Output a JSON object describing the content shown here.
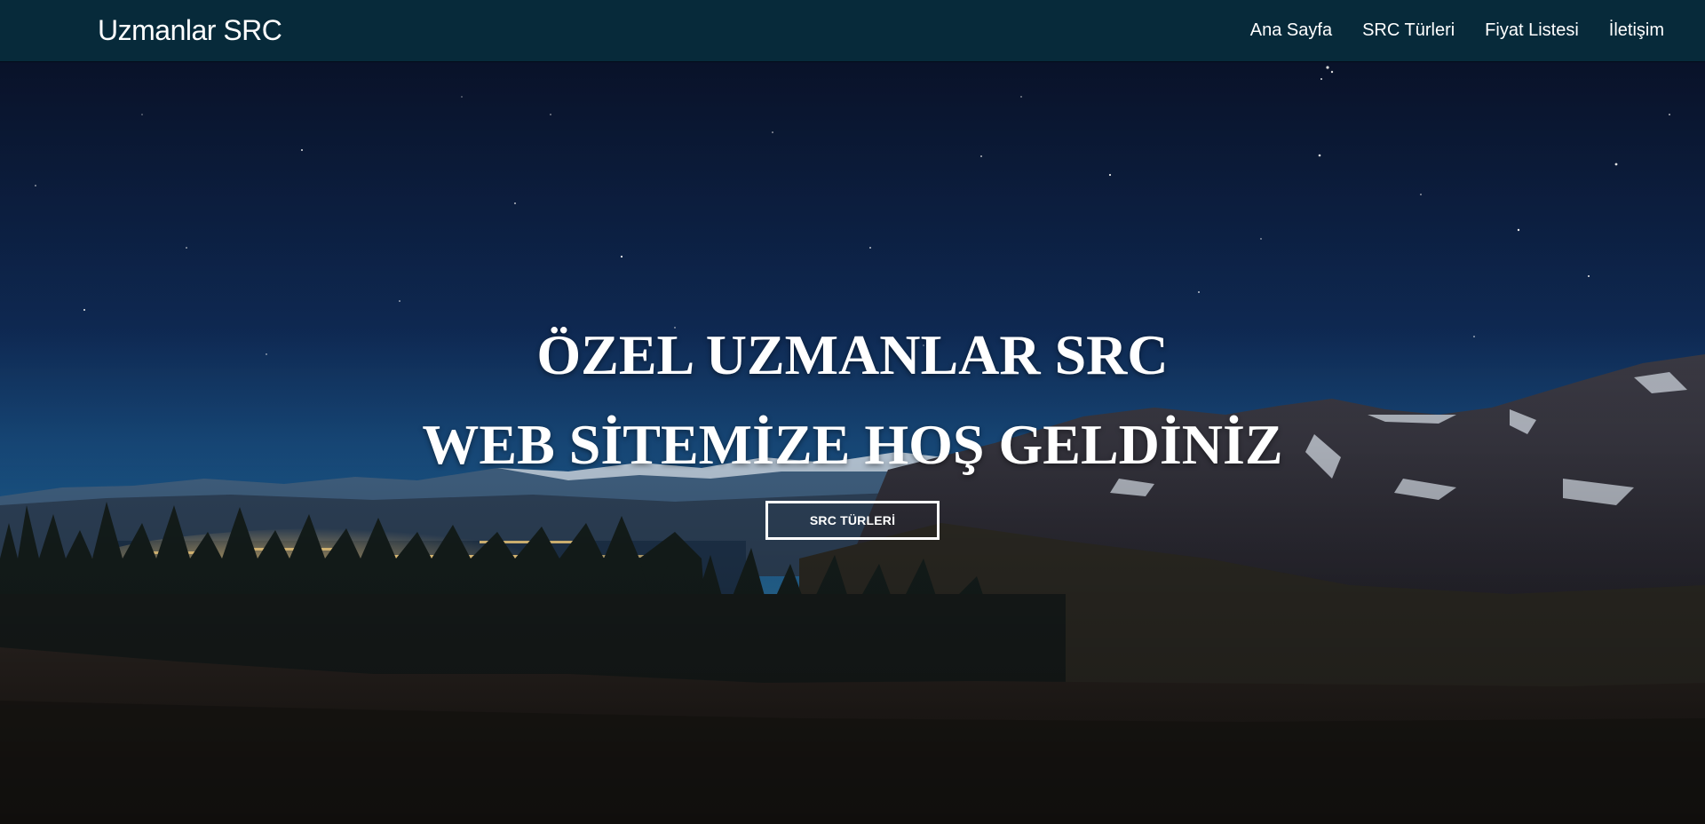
{
  "navbar": {
    "brand": "Uzmanlar SRC",
    "links": [
      {
        "label": "Ana Sayfa"
      },
      {
        "label": "SRC Türleri"
      },
      {
        "label": "Fiyat Listesi"
      },
      {
        "label": "İletişim"
      }
    ]
  },
  "hero": {
    "title_line1": "ÖZEL UZMANLAR SRC",
    "title_line2": "WEB SİTEMİZE HOŞ GELDİNİZ",
    "button_label": "SRC TÜRLERİ"
  },
  "colors": {
    "navbar_bg": "#072a3a",
    "text": "#ffffff",
    "sky_top": "#0a1a3a",
    "sky_horizon": "#1e5a8a"
  }
}
